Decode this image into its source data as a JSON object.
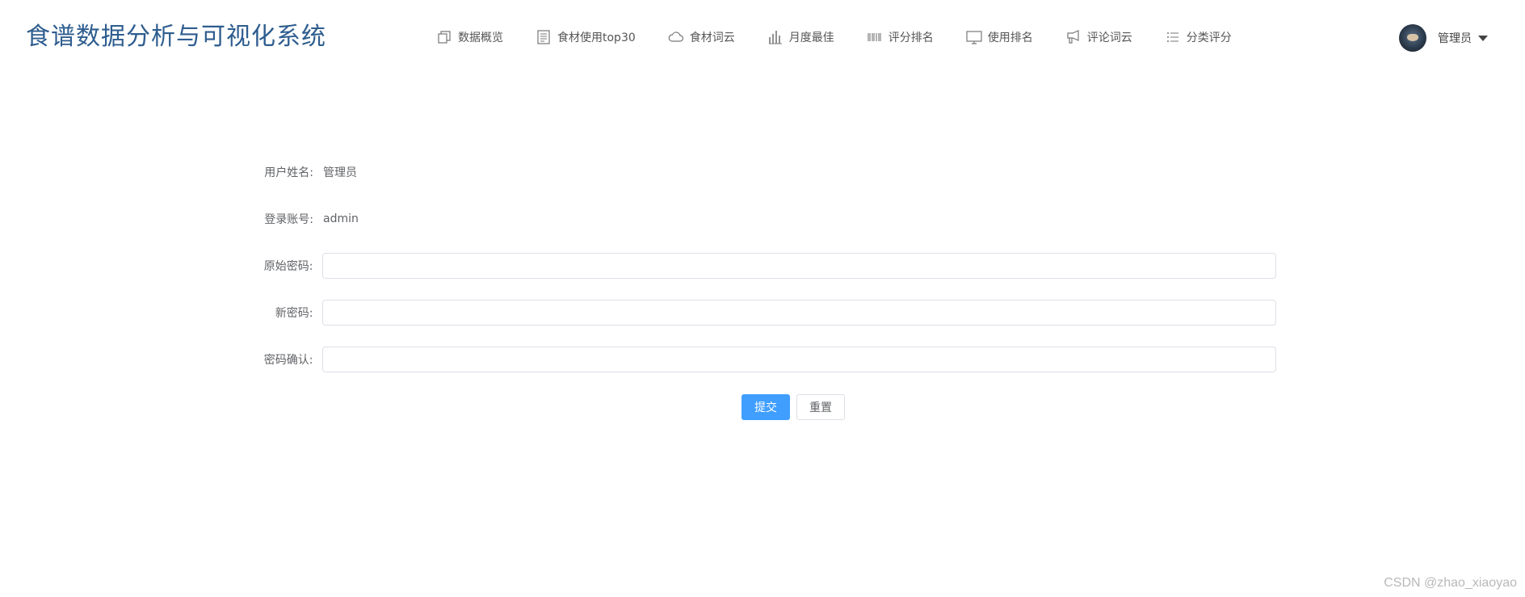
{
  "app": {
    "title": "食谱数据分析与可视化系统"
  },
  "nav": {
    "items": [
      {
        "label": "数据概览",
        "icon": "copy-icon"
      },
      {
        "label": "食材使用top30",
        "icon": "document-icon"
      },
      {
        "label": "食材词云",
        "icon": "cloud-icon"
      },
      {
        "label": "月度最佳",
        "icon": "bar-chart-icon"
      },
      {
        "label": "评分排名",
        "icon": "barcode-icon"
      },
      {
        "label": "使用排名",
        "icon": "monitor-icon"
      },
      {
        "label": "评论词云",
        "icon": "megaphone-icon"
      },
      {
        "label": "分类评分",
        "icon": "list-icon"
      }
    ]
  },
  "user": {
    "name": "管理员",
    "avatar": "avatar"
  },
  "form": {
    "username_label": "用户姓名:",
    "username_value": "管理员",
    "account_label": "登录账号:",
    "account_value": "admin",
    "old_password_label": "原始密码:",
    "old_password_value": "",
    "new_password_label": "新密码:",
    "new_password_value": "",
    "confirm_password_label": "密码确认:",
    "confirm_password_value": "",
    "submit_label": "提交",
    "reset_label": "重置"
  },
  "watermark": "CSDN @zhao_xiaoyao",
  "colors": {
    "title": "#2e5d8f",
    "primary": "#409eff",
    "border": "#dcdfe6"
  }
}
